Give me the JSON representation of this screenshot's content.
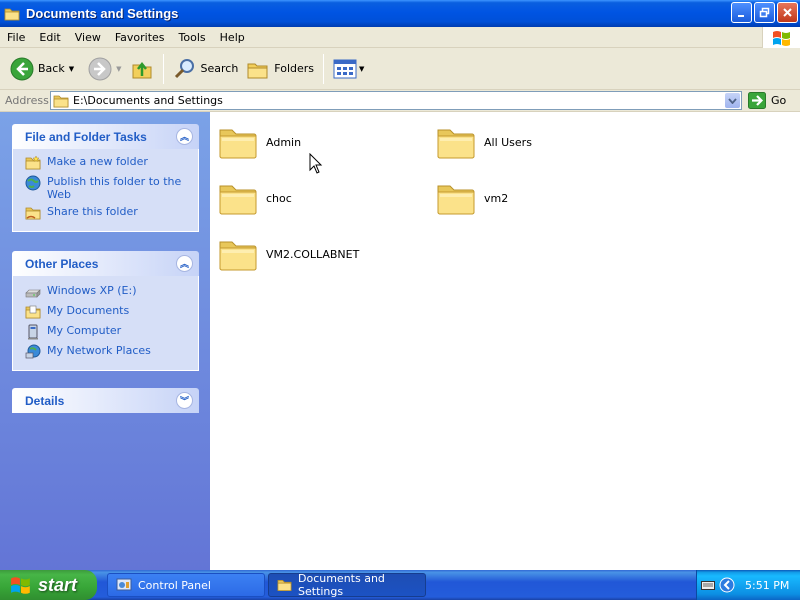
{
  "window": {
    "title": "Documents and Settings"
  },
  "menu": [
    "File",
    "Edit",
    "View",
    "Favorites",
    "Tools",
    "Help"
  ],
  "toolbar": {
    "back_label": "Back",
    "search_label": "Search",
    "folders_label": "Folders"
  },
  "address": {
    "label": "Address",
    "value": "E:\\Documents and Settings",
    "go_label": "Go"
  },
  "panels": {
    "file_tasks": {
      "title": "File and Folder Tasks",
      "items": [
        "Make a new folder",
        "Publish this folder to the Web",
        "Share this folder"
      ]
    },
    "other_places": {
      "title": "Other Places",
      "items": [
        "Windows XP (E:)",
        "My Documents",
        "My Computer",
        "My Network Places"
      ]
    },
    "details": {
      "title": "Details"
    }
  },
  "folders": [
    "Admin",
    "All Users",
    "choc",
    "vm2",
    "VM2.COLLABNET"
  ],
  "taskbar": {
    "start_label": "start",
    "buttons": [
      "Control Panel",
      "Documents and Settings"
    ],
    "clock": "5:51 PM"
  },
  "colors": {
    "titlebar": "#0054e3",
    "taskpane_link": "#215dc6",
    "start_green": "#3c9a3c"
  }
}
